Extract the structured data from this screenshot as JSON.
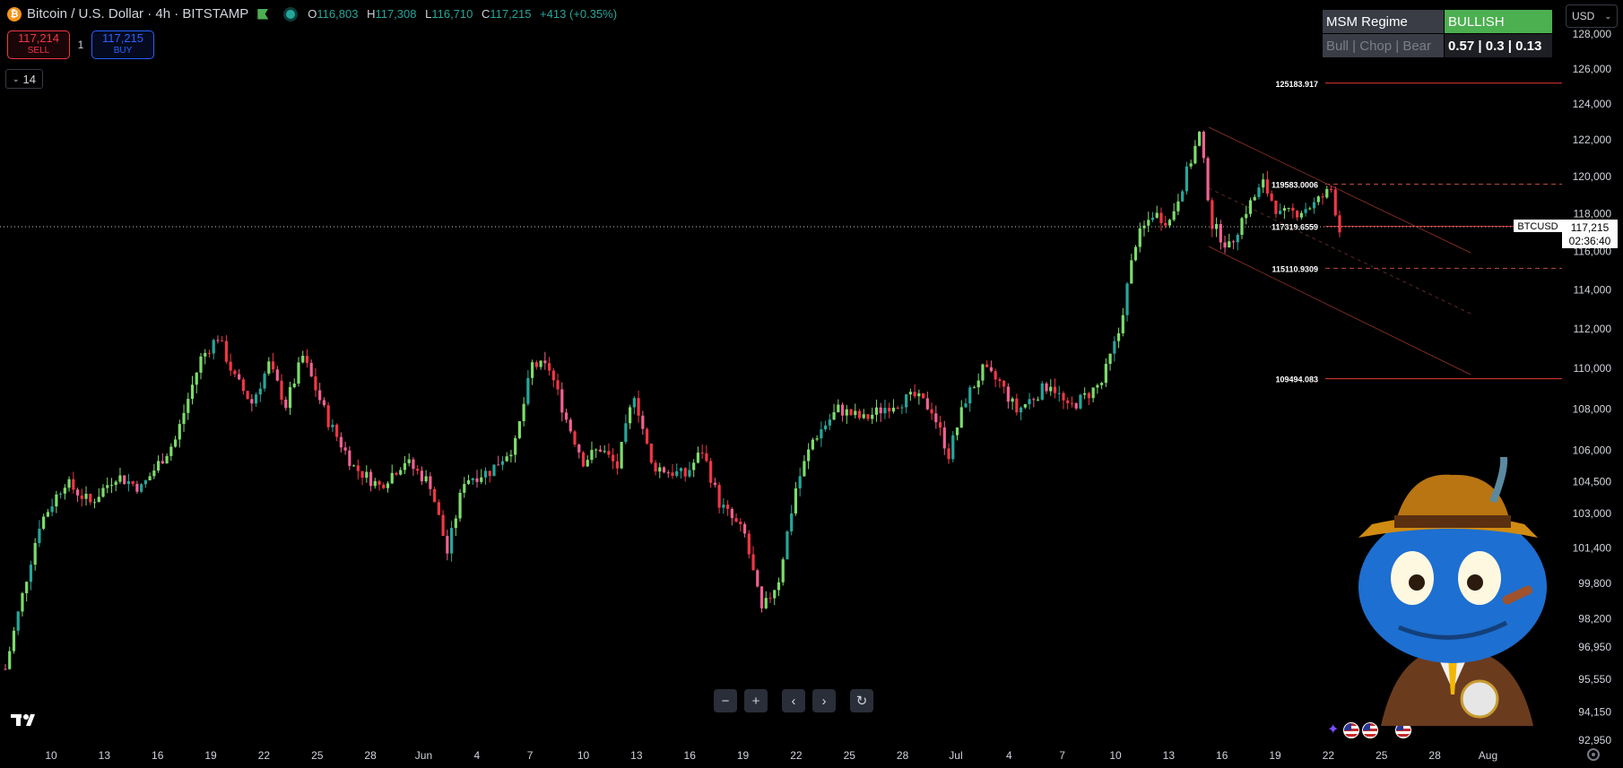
{
  "header": {
    "coin_glyph": "₿",
    "title": "Bitcoin / U.S. Dollar · 4h · BITSTAMP",
    "ohlc": [
      {
        "k": "O",
        "v": "116,803"
      },
      {
        "k": "H",
        "v": "117,308"
      },
      {
        "k": "L",
        "v": "116,710"
      },
      {
        "k": "C",
        "v": "117,215"
      }
    ],
    "change": "+413 (+0.35%)"
  },
  "trade": {
    "sell_price": "117,214",
    "sell_label": "SELL",
    "qty": "1",
    "buy_price": "117,215",
    "buy_label": "BUY"
  },
  "indicator_toggle": {
    "label": "14"
  },
  "msm_table": {
    "title": "MSM Regime",
    "state": "BULLISH",
    "legend": "Bull | Chop | Bear",
    "values": "0.57 | 0.3 | 0.13",
    "state_color": "#4caf50"
  },
  "currency": {
    "label": "USD"
  },
  "colors": {
    "up": "#7ddc6b",
    "up_alt": "#26a69a",
    "down": "#f23645",
    "down_alt": "#f06292",
    "level_line": "#e53935"
  },
  "chart_data": {
    "type": "candlestick",
    "symbol_tag": "BTCUSD",
    "last_price": "117,215",
    "countdown": "02:36:40",
    "y_scale": "log",
    "ylim": [
      92950,
      128000
    ],
    "y_ticks": [
      "128,000",
      "126,000",
      "124,000",
      "122,000",
      "120,000",
      "118,000",
      "116,000",
      "114,000",
      "112,000",
      "110,000",
      "108,000",
      "106,000",
      "104,500",
      "103,000",
      "101,400",
      "99,800",
      "98,200",
      "96,950",
      "95,550",
      "94,150",
      "92,950"
    ],
    "x_ticks": [
      "10",
      "13",
      "16",
      "19",
      "22",
      "25",
      "28",
      "Jun",
      "4",
      "7",
      "10",
      "13",
      "16",
      "19",
      "22",
      "25",
      "28",
      "Jul",
      "4",
      "7",
      "10",
      "13",
      "16",
      "19",
      "22",
      "25",
      "28",
      "Aug"
    ],
    "levels": [
      {
        "label": "125183.917",
        "value": 125183.917,
        "style": "solid"
      },
      {
        "label": "119583.0006",
        "value": 119583.0006,
        "style": "dashed"
      },
      {
        "label": "117319.6559",
        "value": 117319.6559,
        "style": "solid"
      },
      {
        "label": "115110.9309",
        "value": 115110.9309,
        "style": "dashed"
      },
      {
        "label": "109494.083",
        "value": 109494.083,
        "style": "solid"
      }
    ],
    "anchors": [
      [
        0,
        96000
      ],
      [
        8,
        102500
      ],
      [
        14,
        104500
      ],
      [
        20,
        103500
      ],
      [
        26,
        104800
      ],
      [
        32,
        104200
      ],
      [
        40,
        106500
      ],
      [
        46,
        110500
      ],
      [
        50,
        111600
      ],
      [
        54,
        109500
      ],
      [
        58,
        108300
      ],
      [
        62,
        110200
      ],
      [
        66,
        108200
      ],
      [
        70,
        110600
      ],
      [
        76,
        107400
      ],
      [
        82,
        105200
      ],
      [
        88,
        104300
      ],
      [
        94,
        105500
      ],
      [
        100,
        104400
      ],
      [
        104,
        101200
      ],
      [
        108,
        104600
      ],
      [
        114,
        105000
      ],
      [
        120,
        106300
      ],
      [
        124,
        110200
      ],
      [
        128,
        110000
      ],
      [
        132,
        107500
      ],
      [
        136,
        105500
      ],
      [
        140,
        106100
      ],
      [
        144,
        105200
      ],
      [
        148,
        108800
      ],
      [
        152,
        105300
      ],
      [
        156,
        105000
      ],
      [
        160,
        104800
      ],
      [
        164,
        106000
      ],
      [
        168,
        103500
      ],
      [
        174,
        102000
      ],
      [
        178,
        98500
      ],
      [
        182,
        100000
      ],
      [
        186,
        104200
      ],
      [
        190,
        106500
      ],
      [
        196,
        108000
      ],
      [
        202,
        107500
      ],
      [
        208,
        108200
      ],
      [
        214,
        108600
      ],
      [
        218,
        108000
      ],
      [
        222,
        105800
      ],
      [
        226,
        108500
      ],
      [
        230,
        109900
      ],
      [
        234,
        109300
      ],
      [
        238,
        107900
      ],
      [
        242,
        108600
      ],
      [
        246,
        109300
      ],
      [
        250,
        108000
      ],
      [
        254,
        108600
      ],
      [
        258,
        109300
      ],
      [
        262,
        111800
      ],
      [
        266,
        116500
      ],
      [
        270,
        118000
      ],
      [
        274,
        117600
      ],
      [
        278,
        120200
      ],
      [
        281,
        122300
      ],
      [
        284,
        117400
      ],
      [
        288,
        116200
      ],
      [
        292,
        118200
      ],
      [
        296,
        119600
      ],
      [
        300,
        117900
      ],
      [
        304,
        118100
      ],
      [
        308,
        118500
      ],
      [
        312,
        119300
      ],
      [
        314,
        117100
      ]
    ]
  }
}
